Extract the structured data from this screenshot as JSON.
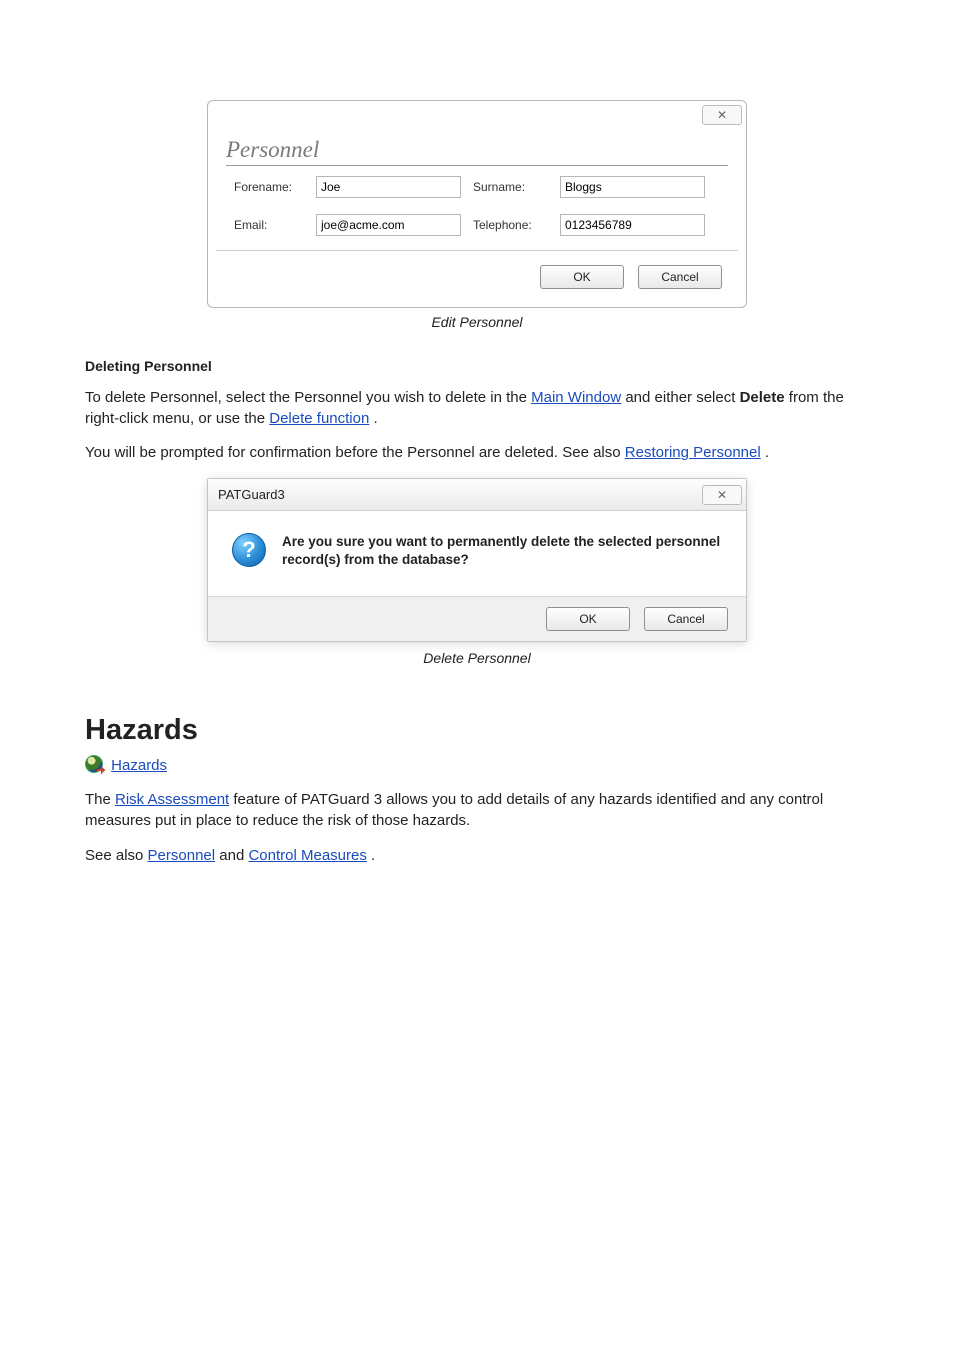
{
  "dialog1": {
    "close_text": "✕",
    "group_label": "Personnel",
    "forename_label": "Forename:",
    "forename_value": "Joe",
    "surname_label": "Surname:",
    "surname_value": "Bloggs",
    "email_label": "Email:",
    "email_value": "joe@acme.com",
    "telephone_label": "Telephone:",
    "telephone_value": "0123456789",
    "ok_label": "OK",
    "cancel_label": "Cancel"
  },
  "caption1": "Edit Personnel",
  "heading_delete": "Deleting Personnel",
  "para_delete_1a": "To delete Personnel, select the Personnel you wish to delete in the ",
  "para_delete_link1": "Main Window",
  "para_delete_1b": " and either select ",
  "para_delete_bold": "Delete",
  "para_delete_1c": " from the right-click menu, or use the ",
  "para_delete_link2": "Delete function",
  "para_delete_1d": ".",
  "para_delete_2a": "You will be prompted for confirmation before the Personnel are deleted. See also ",
  "para_delete_link3": "Restoring Personnel",
  "para_delete_2b": ".",
  "dialog2": {
    "title": "PATGuard3",
    "close_text": "✕",
    "body_text": "Are you sure you want to permanently delete the selected personnel record(s) from the database?",
    "ok_label": "OK",
    "cancel_label": "Cancel"
  },
  "caption2": "Delete Personnel",
  "section_title": "Hazards",
  "link_hazards": " Hazards",
  "hazards_intro": "The Risk Assessment feature of PATGuard 3 allows you to add details of any hazards identified and any control measures put in place to reduce the risk of those hazards.",
  "link_ra": "Risk Assessment",
  "see_also_lead": "See also ",
  "see_also_and": " and ",
  "see_also_end": ".",
  "link_personnel": "Personnel",
  "link_control": "Control Measures"
}
